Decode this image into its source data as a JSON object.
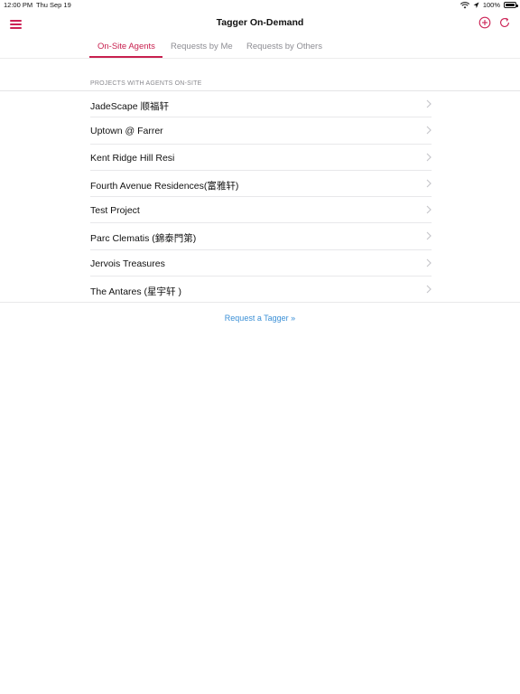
{
  "status_bar": {
    "time": "12:00 PM",
    "date": "Thu Sep 19",
    "battery": "100%",
    "icons": [
      "wifi-icon",
      "location-icon",
      "battery-icon"
    ]
  },
  "header": {
    "title": "Tagger On-Demand",
    "left_icon": "hamburger-menu-icon",
    "right_icons": [
      "add-circle-icon",
      "refresh-icon"
    ],
    "accent_color": "#c8204f"
  },
  "tabs": [
    {
      "label": "On-Site Agents",
      "active": true
    },
    {
      "label": "Requests by Me",
      "active": false
    },
    {
      "label": "Requests by Others",
      "active": false
    }
  ],
  "section": {
    "header": "PROJECTS WITH AGENTS ON-SITE"
  },
  "projects": [
    {
      "name": "JadeScape 顺福轩"
    },
    {
      "name": "Uptown @ Farrer"
    },
    {
      "name": "Kent Ridge Hill Resi"
    },
    {
      "name": "Fourth Avenue Residences(富雅轩)"
    },
    {
      "name": "Test Project"
    },
    {
      "name": "Parc Clematis (錦泰門第)"
    },
    {
      "name": "Jervois Treasures"
    },
    {
      "name": "The Antares (星宇轩 )"
    }
  ],
  "footer": {
    "request_link": "Request a Tagger »",
    "link_color": "#3a8fd6"
  }
}
